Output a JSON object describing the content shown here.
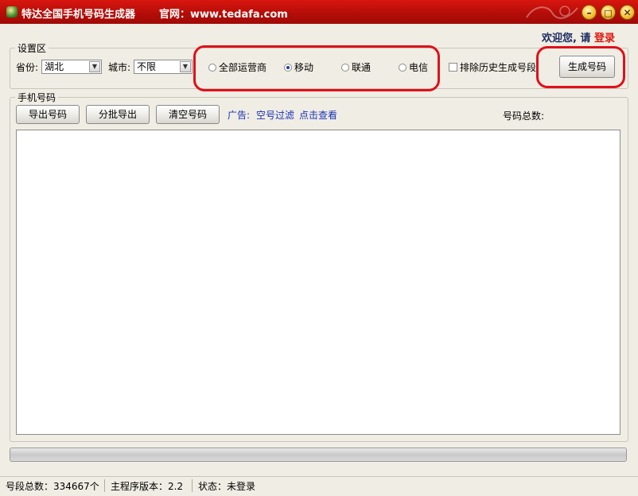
{
  "window": {
    "title": "特达全国手机号码生成器",
    "site": "官网：www.tedafa.com",
    "minimize_glyph": "–",
    "maximize_glyph": "□",
    "close_glyph": "✕"
  },
  "header": {
    "welcome": "欢迎您, 请",
    "login": "登录"
  },
  "settings": {
    "legend": "设置区",
    "province_label": "省份:",
    "province_value": "湖北",
    "city_label": "城市:",
    "city_value": "不限",
    "carriers": [
      {
        "label": "全部运营商",
        "selected": false
      },
      {
        "label": "移动",
        "selected": true
      },
      {
        "label": "联通",
        "selected": false
      },
      {
        "label": "电信",
        "selected": false
      }
    ],
    "exclude_history_label": "排除历史生成号段",
    "exclude_history_checked": false,
    "generate_button": "生成号码"
  },
  "numbers": {
    "legend": "手机号码",
    "export_button": "导出号码",
    "batch_export_button": "分批导出",
    "clear_button": "清空号码",
    "ad_prefix": "广告:",
    "ad_text": "空号过滤",
    "ad_link": "点击查看",
    "total_label": "号码总数:",
    "content": ""
  },
  "progress": {
    "value": 0
  },
  "statusbar": {
    "segments": "号段总数：334667个",
    "version": "主程序版本：2.2",
    "status": "状态：未登录"
  },
  "colors": {
    "titlebar": "#c4120c",
    "highlight_ring": "#e0101a",
    "login": "#e0160c",
    "ad": "#1a33b5",
    "background": "#f0ede4"
  }
}
